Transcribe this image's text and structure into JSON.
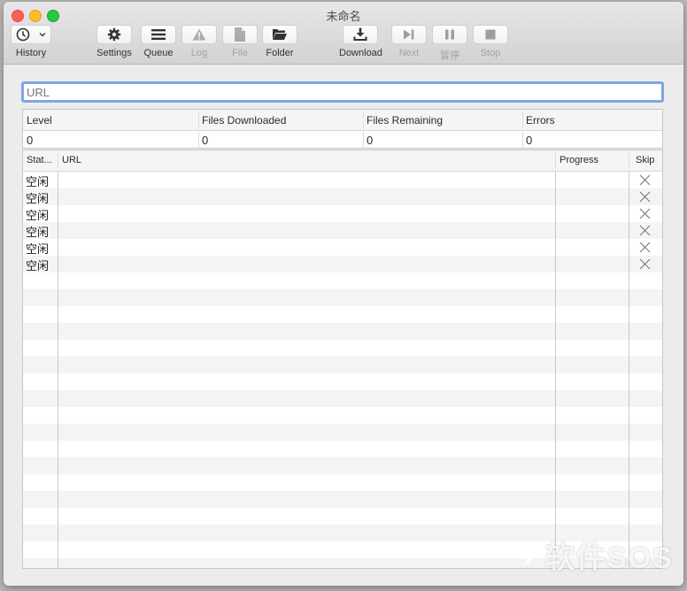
{
  "window": {
    "title": "未命名"
  },
  "toolbar": {
    "history": {
      "label": "History",
      "icon": "clock-icon"
    },
    "settings": {
      "label": "Settings",
      "icon": "gear-icon"
    },
    "queue": {
      "label": "Queue",
      "icon": "list-icon"
    },
    "log": {
      "label": "Log",
      "icon": "warning-icon",
      "enabled": false
    },
    "file": {
      "label": "File",
      "icon": "document-icon",
      "enabled": false
    },
    "folder": {
      "label": "Folder",
      "icon": "folder-icon"
    },
    "download": {
      "label": "Download",
      "icon": "download-icon"
    },
    "next": {
      "label": "Next",
      "icon": "skip-forward-icon",
      "enabled": false
    },
    "pause": {
      "label": "暂停",
      "icon": "pause-icon",
      "enabled": false
    },
    "stop": {
      "label": "Stop",
      "icon": "stop-icon",
      "enabled": false
    }
  },
  "url_input": {
    "value": "",
    "placeholder": "URL"
  },
  "stats": {
    "headers": [
      "Level",
      "Files Downloaded",
      "Files Remaining",
      "Errors"
    ],
    "values": [
      "0",
      "0",
      "0",
      "0"
    ]
  },
  "queue_table": {
    "columns": [
      "Stat...",
      "URL",
      "Progress",
      "Skip"
    ],
    "rows": [
      {
        "status": "空闲",
        "url": "",
        "progress": ""
      },
      {
        "status": "空闲",
        "url": "",
        "progress": ""
      },
      {
        "status": "空闲",
        "url": "",
        "progress": ""
      },
      {
        "status": "空闲",
        "url": "",
        "progress": ""
      },
      {
        "status": "空闲",
        "url": "",
        "progress": ""
      },
      {
        "status": "空闲",
        "url": "",
        "progress": ""
      }
    ]
  },
  "watermark": "软件SOS"
}
